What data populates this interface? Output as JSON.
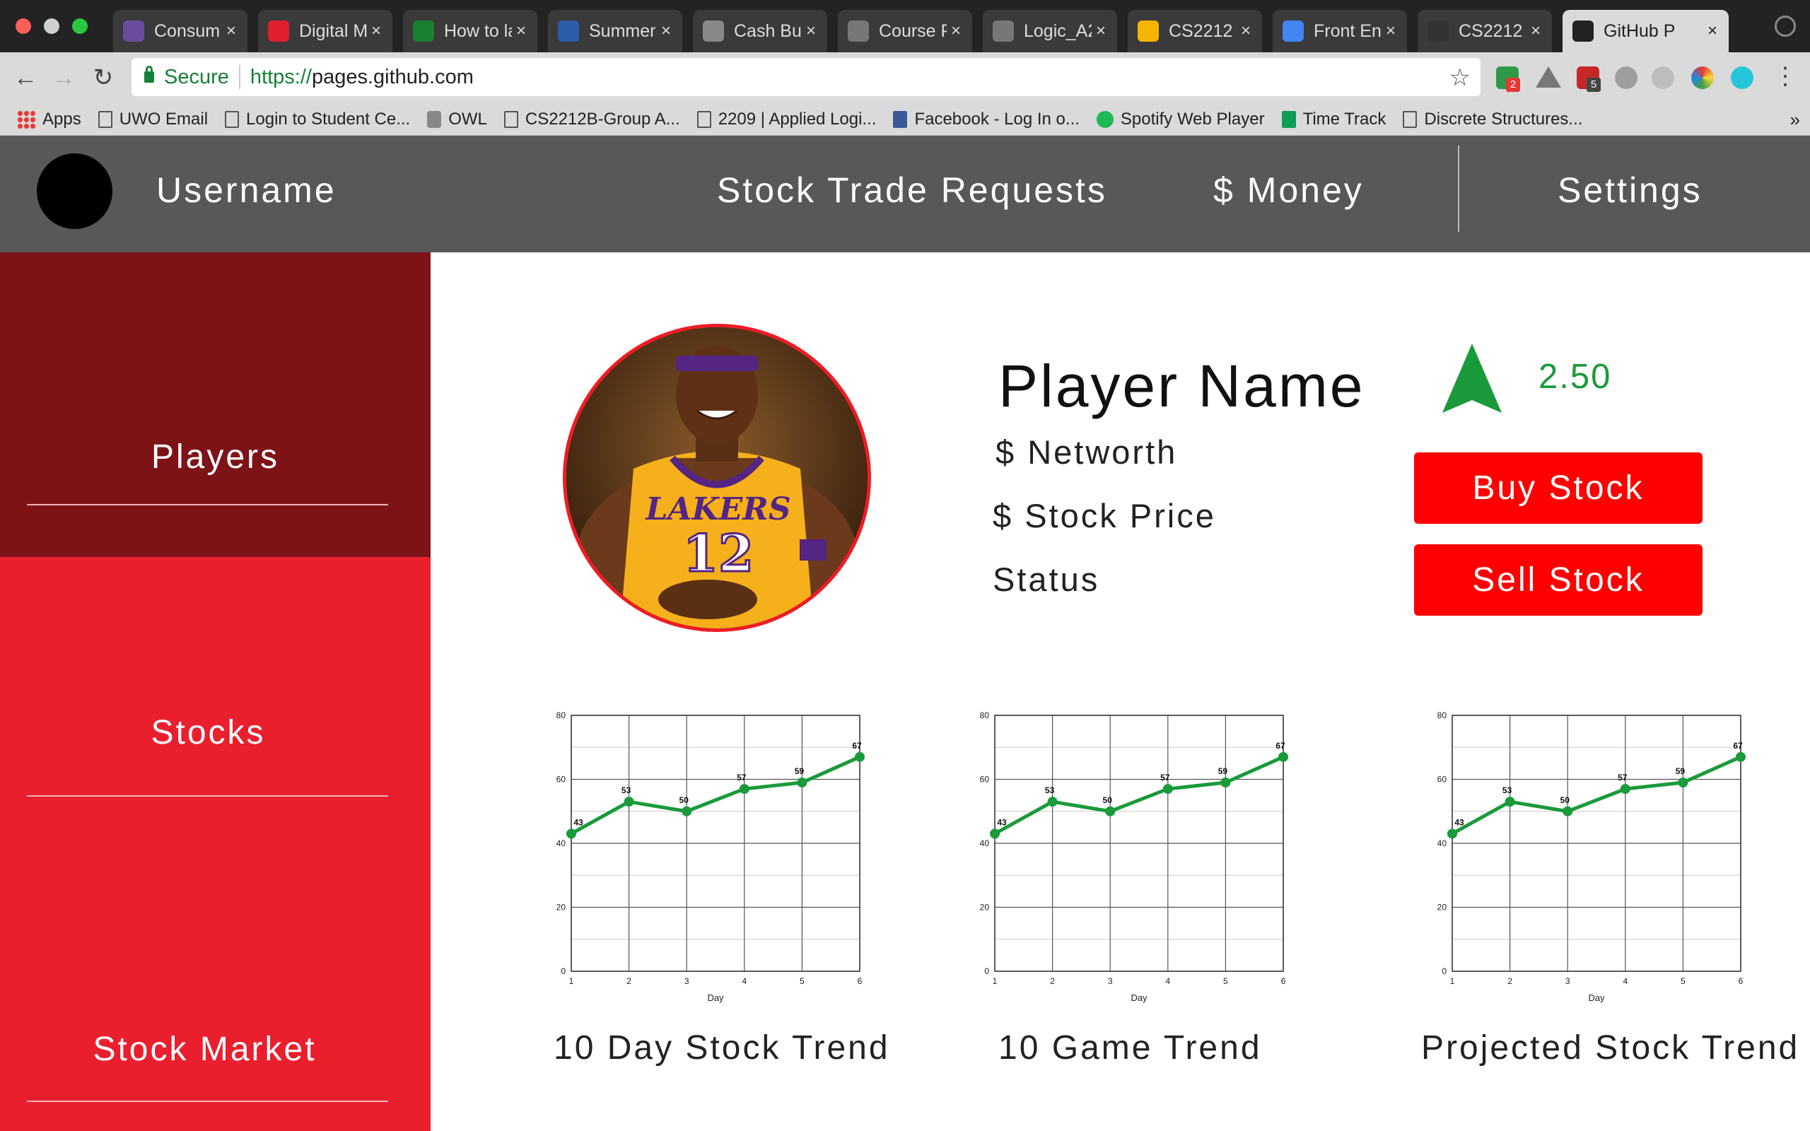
{
  "browser": {
    "tabs": [
      {
        "label": "Consum",
        "favicon_color": "#6a4c9c"
      },
      {
        "label": "Digital M",
        "favicon_color": "#e0202c"
      },
      {
        "label": "How to la",
        "favicon_color": "#1a7f2e"
      },
      {
        "label": "Summer",
        "favicon_color": "#2a5caa"
      },
      {
        "label": "Cash Bu",
        "favicon_color": "#888888"
      },
      {
        "label": "Course P",
        "favicon_color": "#777777"
      },
      {
        "label": "Logic_A2",
        "favicon_color": "#777777"
      },
      {
        "label": "CS2212",
        "favicon_color": "#f4b400"
      },
      {
        "label": "Front En",
        "favicon_color": "#4285f4"
      },
      {
        "label": "CS2212",
        "favicon_color": "#333333"
      },
      {
        "label": "GitHub P",
        "favicon_color": "#222222",
        "active": true
      }
    ],
    "secure_label": "Secure",
    "url_protocol": "https://",
    "url_host": "pages.github.com",
    "bookmarks": [
      {
        "label": "Apps",
        "icon": "apps-icon"
      },
      {
        "label": "UWO Email",
        "icon": "page-icon"
      },
      {
        "label": "Login to Student Ce...",
        "icon": "page-icon"
      },
      {
        "label": "OWL",
        "icon": "owl-icon"
      },
      {
        "label": "CS2212B-Group A...",
        "icon": "page-icon"
      },
      {
        "label": "2209 | Applied Logi...",
        "icon": "page-icon"
      },
      {
        "label": "Facebook - Log In o...",
        "icon": "facebook-icon"
      },
      {
        "label": "Spotify Web Player",
        "icon": "spotify-icon"
      },
      {
        "label": "Time Track",
        "icon": "sheets-icon"
      },
      {
        "label": "Discrete Structures...",
        "icon": "page-icon"
      }
    ],
    "extension_badges": [
      "2",
      "5"
    ]
  },
  "header": {
    "username": "Username",
    "stock_trade_requests": "Stock Trade Requests",
    "money": "$ Money",
    "settings": "Settings"
  },
  "sidebar": {
    "players": "Players",
    "stocks": "Stocks",
    "stock_market": "Stock Market"
  },
  "player": {
    "name": "Player Name",
    "networth": "$ Networth",
    "stock_price": "$ Stock Price",
    "status": "Status",
    "change": "2.50",
    "jersey_team": "LAKERS",
    "jersey_number": "12",
    "buy_label": "Buy Stock",
    "sell_label": "Sell Stock"
  },
  "colors": {
    "header_bg": "#58585a",
    "sidebar_active": "#7d1317",
    "sidebar_bg": "#ea1f2e",
    "button_bg": "#fe0000",
    "trend_green": "#1a9a3a"
  },
  "chart_data": [
    {
      "type": "line",
      "title": "10 Day Stock Trend",
      "xlabel": "Day",
      "ylabel": "",
      "x": [
        1,
        2,
        3,
        4,
        5,
        6
      ],
      "series": [
        {
          "values": [
            43,
            53,
            50,
            57,
            59,
            67
          ]
        }
      ],
      "ylim": [
        0,
        80
      ],
      "yticks": [
        0,
        20,
        40,
        60,
        80
      ],
      "grid": true,
      "color": "#1a9a3a"
    },
    {
      "type": "line",
      "title": "10 Game Trend",
      "xlabel": "Day",
      "ylabel": "",
      "x": [
        1,
        2,
        3,
        4,
        5,
        6
      ],
      "series": [
        {
          "values": [
            43,
            53,
            50,
            57,
            59,
            67
          ]
        }
      ],
      "ylim": [
        0,
        80
      ],
      "yticks": [
        0,
        20,
        40,
        60,
        80
      ],
      "grid": true,
      "color": "#1a9a3a"
    },
    {
      "type": "line",
      "title": "Projected Stock Trend",
      "xlabel": "Day",
      "ylabel": "",
      "x": [
        1,
        2,
        3,
        4,
        5,
        6
      ],
      "series": [
        {
          "values": [
            43,
            53,
            50,
            57,
            59,
            67
          ]
        }
      ],
      "ylim": [
        0,
        80
      ],
      "yticks": [
        0,
        20,
        40,
        60,
        80
      ],
      "grid": true,
      "color": "#1a9a3a"
    }
  ]
}
